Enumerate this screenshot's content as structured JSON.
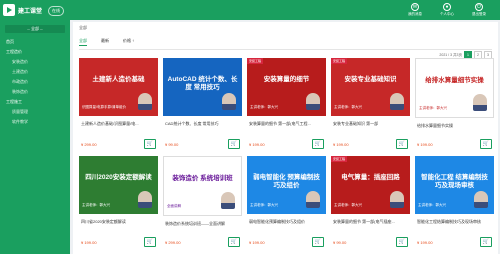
{
  "app": {
    "brand": "建工课堂",
    "mode": "在线"
  },
  "topbar": {
    "messages_label": "我的消息",
    "user_label": "个人中心",
    "logout_label": "退出登录"
  },
  "sidebar": {
    "dropdown": "-- 全部 --",
    "items": [
      {
        "label": "首页",
        "sub": false
      },
      {
        "label": "工程造价",
        "sub": false
      },
      {
        "label": "安装造价",
        "sub": true
      },
      {
        "label": "土建造价",
        "sub": true
      },
      {
        "label": "市政造价",
        "sub": true
      },
      {
        "label": "装饰造价",
        "sub": true
      },
      {
        "label": "工程施工",
        "sub": false
      },
      {
        "label": "质量管理",
        "sub": true
      },
      {
        "label": "软件教学",
        "sub": true
      }
    ]
  },
  "breadcrumb": "全部",
  "filters": [
    "全部",
    "最新",
    "价格 ↑"
  ],
  "pager": {
    "text": "2021 / 3 共3页",
    "pages": [
      "1",
      "2",
      "3"
    ]
  },
  "cards": [
    {
      "thumb": "土建新人造价基础",
      "sub": "识图算量/电算手算/清单组价",
      "title": "土建新人造价基础/识图算量/电...",
      "price": "¥ 299.00",
      "bg": "#c62828",
      "fg": "#ffffff",
      "badge": ""
    },
    {
      "thumb": "AutoCAD 统计个数、长度 常用技巧",
      "sub": "",
      "title": "CAD统计个数、长度 常用技巧",
      "price": "¥ 99.00",
      "bg": "#1565c0",
      "fg": "#ffffff",
      "badge": ""
    },
    {
      "thumb": "安装算量的细节",
      "sub": "主讲老师：郭大兴",
      "title": "安装算量的细节 第一部(电气工程...",
      "price": "¥ 199.00",
      "bg": "#b71c1c",
      "fg": "#ffffff",
      "badge": "安装工程"
    },
    {
      "thumb": "安装专业基础知识",
      "sub": "主讲老师：郭大兴",
      "title": "安装专业基础知识 第一部",
      "price": "¥ 199.00",
      "bg": "#c62828",
      "fg": "#ffffff",
      "badge": "安装工程"
    },
    {
      "thumb": "给排水算量细节实操",
      "sub": "主讲老师：郭大兴",
      "title": "给排水算量细节实操",
      "price": "¥ 199.00",
      "bg": "#ffffff",
      "fg": "#c62828",
      "badge": ""
    },
    {
      "thumb": "四川2020安装定额解读",
      "sub": "主讲老师：郭大兴",
      "title": "四川省2020安装定额解读",
      "price": "¥ 199.00",
      "bg": "#2e7d32",
      "fg": "#ffffff",
      "badge": ""
    },
    {
      "thumb": "装饰造价 系统培训班",
      "sub": "全面讲解",
      "title": "装饰造价系统培训班——全面讲解",
      "price": "¥ 299.00",
      "bg": "#ffffff",
      "fg": "#6a1b9a",
      "badge": ""
    },
    {
      "thumb": "弱电智能化 预算编制技巧及组价",
      "sub": "主讲老师：郭大兴",
      "title": "弱电智能化预算编制技巧及组价",
      "price": "¥ 199.00",
      "bg": "#1e88e5",
      "fg": "#ffffff",
      "badge": ""
    },
    {
      "thumb": "电气算量：插座回路",
      "sub": "主讲老师：郭大兴",
      "title": "安装算量的细节 第一部(电气插座...",
      "price": "¥ 99.00",
      "bg": "#b71c1c",
      "fg": "#ffffff",
      "badge": "安装工程"
    },
    {
      "thumb": "智能化工程 结算编制技巧及现场审核",
      "sub": "主讲老师：郭大兴",
      "title": "智能化工程结算编制技巧及现场审核",
      "price": "¥ 199.00",
      "bg": "#1e88e5",
      "fg": "#ffffff",
      "badge": ""
    }
  ]
}
